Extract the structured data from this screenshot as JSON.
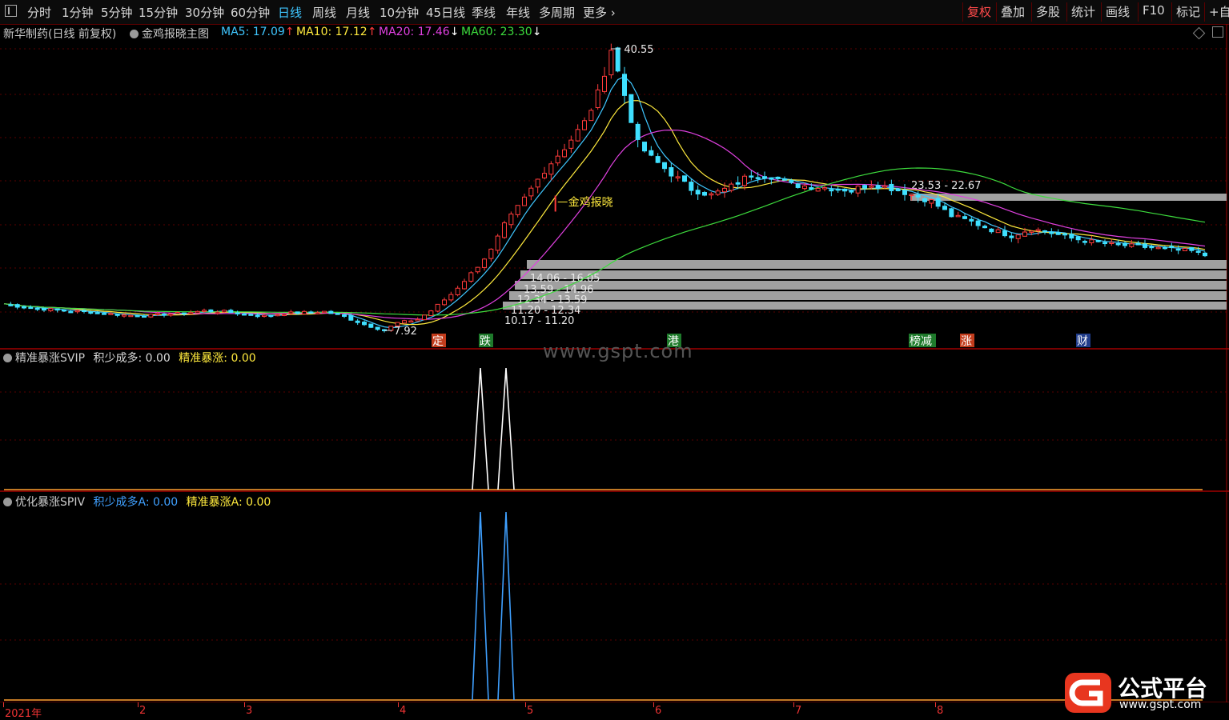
{
  "toolbar": {
    "periods": [
      "分时",
      "1分钟",
      "5分钟",
      "15分钟",
      "30分钟",
      "60分钟",
      "日线",
      "周线",
      "月线",
      "10分钟",
      "45日线",
      "季线",
      "年线",
      "多周期",
      "更多"
    ],
    "active_period": "日线",
    "right_buttons": [
      "复权",
      "叠加",
      "多股",
      "统计",
      "画线",
      "F10",
      "标记",
      "+自"
    ],
    "active_right": "复权"
  },
  "main_panel": {
    "stock_title": "新华制药(日线 前复权)",
    "indicator_name": "金鸡报晓主图",
    "ma": [
      {
        "label": "MA5:",
        "value": "17.09",
        "arrow": "↑",
        "color": "#3fc6ff"
      },
      {
        "label": "MA10:",
        "value": "17.12",
        "arrow": "↑",
        "color": "#ffea3d"
      },
      {
        "label": "MA20:",
        "value": "17.46",
        "arrow": "↓",
        "color": "#e040e0"
      },
      {
        "label": "MA60:",
        "value": "23.30",
        "arrow": "↓",
        "color": "#3ddc3d"
      }
    ],
    "high_label": "40.55",
    "low_label": "7.92",
    "signal_label": "金鸡报晓",
    "zone_labels": [
      "23.53 - 22.67",
      "14.06 - 16.05",
      "13.59 - 14.96",
      "12.34 - 13.59",
      "11.20 - 12.34",
      "10.17 - 11.20"
    ],
    "event_markers": [
      {
        "text": "定",
        "bg": "#c23c1c",
        "fg": "#ffffff"
      },
      {
        "text": "跌",
        "bg": "#1e7a2b",
        "fg": "#ffffff"
      },
      {
        "text": "港",
        "bg": "#1e7a2b",
        "fg": "#ffffff"
      },
      {
        "text": "榜减",
        "bg": "#1e7a2b",
        "fg": "#ffffff"
      },
      {
        "text": "涨",
        "bg": "#c23c1c",
        "fg": "#ffffff"
      },
      {
        "text": "财",
        "bg": "#203c8a",
        "fg": "#ffffff"
      }
    ],
    "watermark": "www.gspt.com"
  },
  "panel2": {
    "name": "精准暴涨SVIP",
    "fields": [
      {
        "label": "积少成多:",
        "value": "0.00",
        "color": "#d8d8d8"
      },
      {
        "label": "精准暴涨:",
        "value": "0.00",
        "color": "#ffea3d"
      }
    ]
  },
  "panel3": {
    "name": "优化暴涨SPIV",
    "fields": [
      {
        "label": "积少成多A:",
        "value": "0.00",
        "color": "#3fa0ff"
      },
      {
        "label": "精准暴涨A:",
        "value": "0.00",
        "color": "#ffea3d"
      }
    ]
  },
  "x_axis_labels": [
    "2021年",
    "2",
    "3",
    "4",
    "5",
    "6",
    "7",
    "8"
  ],
  "logo": {
    "name": "公式平台",
    "url": "www.gspt.com"
  },
  "chart_data": {
    "type": "line",
    "title": "新华制药(日线 前复权)",
    "ylim": [
      7,
      42
    ],
    "x": [
      "2021-01",
      "2021-02",
      "2021-03",
      "2021-04",
      "2021-05",
      "2021-06",
      "2021-07",
      "2021-08"
    ],
    "close_path": [
      [
        0,
        11.0
      ],
      [
        3,
        10.6
      ],
      [
        6,
        10.4
      ],
      [
        9,
        10.2
      ],
      [
        12,
        10.1
      ],
      [
        15,
        9.9
      ],
      [
        18,
        9.7
      ],
      [
        21,
        9.6
      ],
      [
        24,
        9.8
      ],
      [
        27,
        9.9
      ],
      [
        30,
        10.2
      ],
      [
        33,
        10.1
      ],
      [
        36,
        9.8
      ],
      [
        39,
        9.6
      ],
      [
        42,
        9.9
      ],
      [
        45,
        10.0
      ],
      [
        48,
        10.1
      ],
      [
        51,
        9.5
      ],
      [
        54,
        8.6
      ],
      [
        57,
        7.92
      ],
      [
        59,
        8.8
      ],
      [
        62,
        9.2
      ],
      [
        64,
        10.2
      ],
      [
        67,
        12.1
      ],
      [
        70,
        14.5
      ],
      [
        73,
        17.2
      ],
      [
        75,
        20.1
      ],
      [
        78,
        23.2
      ],
      [
        81,
        26.5
      ],
      [
        84,
        29.1
      ],
      [
        87,
        32.0
      ],
      [
        89,
        35.3
      ],
      [
        91,
        40.55
      ],
      [
        93,
        35.2
      ],
      [
        95,
        29.6
      ],
      [
        97,
        27.9
      ],
      [
        100,
        26.1
      ],
      [
        103,
        24.3
      ],
      [
        106,
        23.6
      ],
      [
        109,
        24.6
      ],
      [
        112,
        26.0
      ],
      [
        115,
        25.8
      ],
      [
        118,
        24.8
      ],
      [
        121,
        24.6
      ],
      [
        124,
        24.4
      ],
      [
        127,
        24.2
      ],
      [
        130,
        24.9
      ],
      [
        133,
        24.4
      ],
      [
        136,
        23.7
      ],
      [
        139,
        22.9
      ],
      [
        142,
        21.2
      ],
      [
        145,
        20.5
      ],
      [
        148,
        19.6
      ],
      [
        151,
        18.9
      ],
      [
        154,
        19.7
      ],
      [
        157,
        19.2
      ],
      [
        160,
        18.6
      ],
      [
        163,
        18.2
      ],
      [
        166,
        17.9
      ],
      [
        169,
        17.7
      ],
      [
        172,
        17.5
      ],
      [
        175,
        17.3
      ],
      [
        178,
        17.1
      ],
      [
        180,
        16.6
      ]
    ],
    "series": [
      {
        "name": "MA5",
        "last": 17.09
      },
      {
        "name": "MA10",
        "last": 17.12
      },
      {
        "name": "MA20",
        "last": 17.46
      },
      {
        "name": "MA60",
        "last": 23.3
      }
    ],
    "panel2_spikes": [
      {
        "x": "2021-04-21",
        "y": 1
      },
      {
        "x": "2021-04-27",
        "y": 1
      }
    ],
    "panel3_spikes": [
      {
        "x": "2021-04-21",
        "y": 1
      },
      {
        "x": "2021-04-27",
        "y": 1
      }
    ]
  }
}
